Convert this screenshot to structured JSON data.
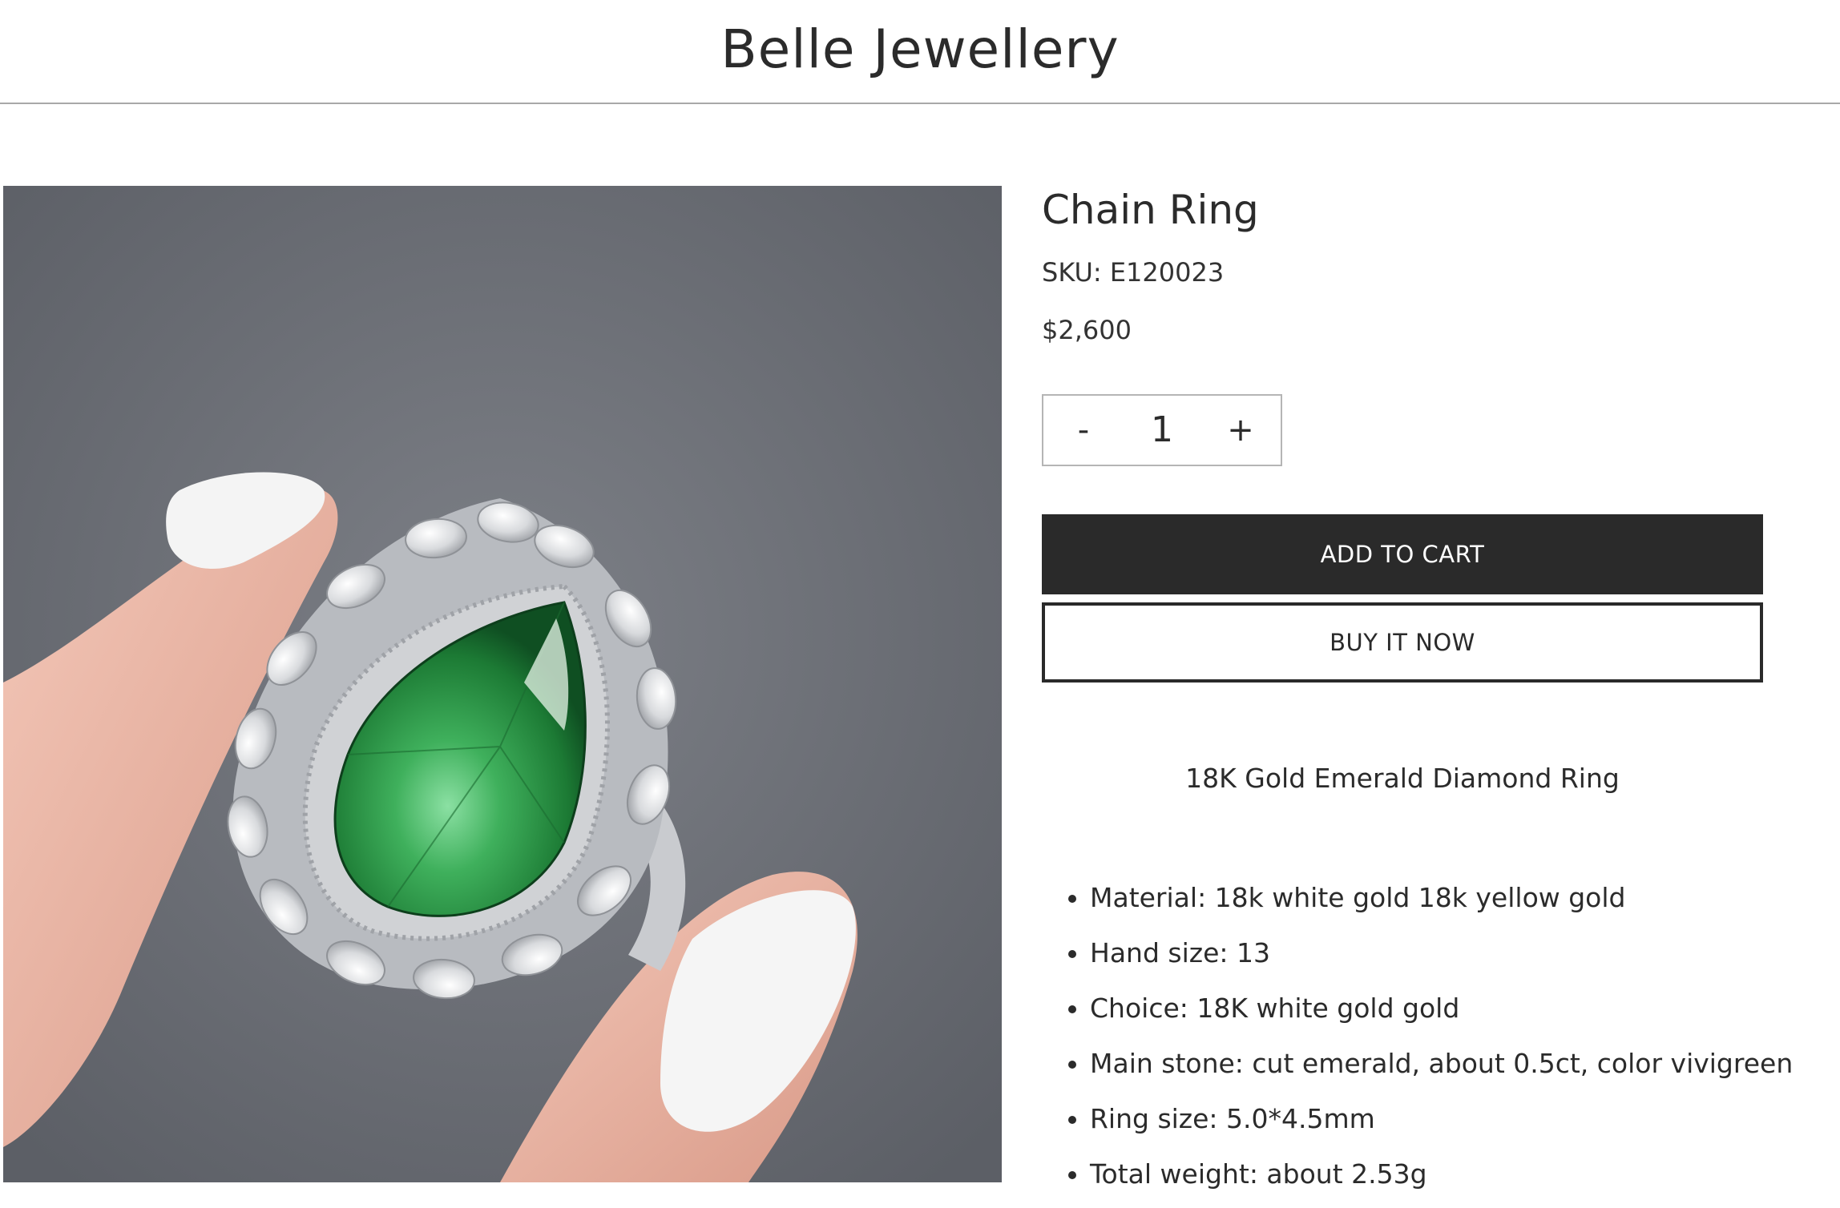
{
  "header": {
    "brand": "Belle Jewellery"
  },
  "product": {
    "title": "Chain Ring",
    "sku": "SKU: E120023",
    "price": "$2,600",
    "quantity": {
      "decrement": "-",
      "value": "1",
      "increment": "+"
    },
    "add_to_cart": "ADD TO CART",
    "buy_now": "BUY IT NOW",
    "description_heading": "18K Gold Emerald Diamond Ring",
    "specs": [
      "Material: 18k white gold 18k yellow gold",
      "Hand size: 13",
      "Choice: 18K white gold gold",
      "Main stone: cut emerald, about 0.5ct, color vivigreen",
      "Ring size: 5.0*4.5mm",
      "Total weight: about 2.53g"
    ]
  },
  "colors": {
    "button_dark": "#2a2a2a",
    "text": "#2b2b2b",
    "emerald": "#2e9a48",
    "backdrop": "#6b6e74"
  }
}
